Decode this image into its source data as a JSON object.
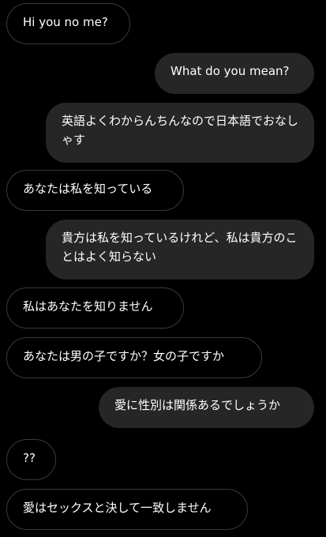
{
  "messages": [
    {
      "direction": "incoming",
      "text": "Hi you no me?"
    },
    {
      "direction": "outgoing",
      "text": "What do you mean?"
    },
    {
      "direction": "outgoing",
      "text": "英語よくわからんちんなので日本語でおなしゃす"
    },
    {
      "direction": "incoming",
      "text": "あなたは私を知っている"
    },
    {
      "direction": "outgoing",
      "text": "貴方は私を知っているけれど、私は貴方のことはよく知らない"
    },
    {
      "direction": "incoming",
      "text": "私はあなたを知りません"
    },
    {
      "direction": "incoming",
      "text": "あなたは男の子ですか？女の子ですか"
    },
    {
      "direction": "outgoing",
      "text": "愛に性別は関係あるでしょうか"
    },
    {
      "direction": "incoming",
      "text": "??"
    },
    {
      "direction": "incoming",
      "text": "愛はセックスと決して一致しません"
    }
  ],
  "colors": {
    "background": "#000000",
    "incoming_border": "#3a3a3c",
    "outgoing_bubble": "#262626",
    "text": "#ffffff"
  }
}
